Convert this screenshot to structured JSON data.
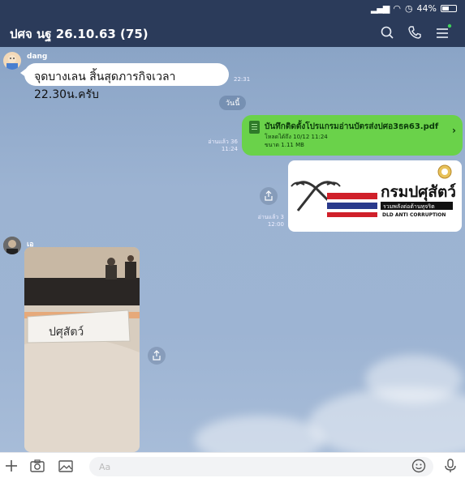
{
  "status": {
    "battery_text": "44%"
  },
  "header": {
    "title": "ปศจ นฐ 26.10.63 (75)"
  },
  "messages": {
    "m1": {
      "sender": "dang",
      "text": "จุดบางเลน  สิ้นสุดภารกิจเวลา 22.30น.ครับ",
      "time": "22:31"
    },
    "date_divider": "วันนี้",
    "file": {
      "name": "บันทึกติดตั้งโปรแกรมอ่านบัตรส่งปศอ3ธค63.pdf",
      "expiry": "โหลดได้ถึง 10/12 11:24",
      "size": "ขนาด 1.11 MB",
      "read_label": "อ่านแล้ว 36",
      "time": "11:24"
    },
    "logo": {
      "title": "กรมปศุสัตว์",
      "subtitle": "รวมพลังต่อต้านทุจริต",
      "banner": "DLD ANTI CORRUPTION",
      "read_label": "อ่านแล้ว 3",
      "time": "12:00"
    },
    "photo": {
      "sender": "เอ",
      "sign_text": "ปศุสัตว์"
    }
  },
  "input": {
    "placeholder": "Aa"
  },
  "colors": {
    "header_bg": "#2b3b5a",
    "sent_bubble": "#6ad24a"
  },
  "icons": [
    "search-icon",
    "phone-icon",
    "menu-icon",
    "plus-icon",
    "camera-icon",
    "image-icon",
    "emoji-icon",
    "microphone-icon",
    "share-icon",
    "pdf-file-icon",
    "chevron-right-icon"
  ]
}
